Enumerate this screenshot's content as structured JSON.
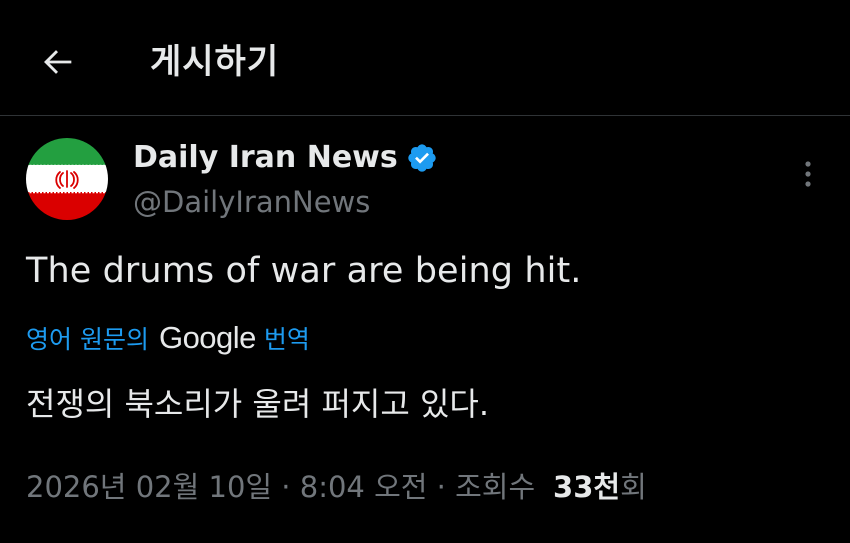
{
  "header": {
    "title": "게시하기",
    "back_icon": "arrow-left-icon"
  },
  "tweet": {
    "author": {
      "name": "Daily Iran News",
      "handle": "@DailyIranNews",
      "verified": true,
      "avatar": "iran-flag-icon"
    },
    "more_icon": "more-vertical-icon",
    "text": "The drums of war are being hit.",
    "translation": {
      "source_label": "영어 원문의",
      "provider": "Google",
      "action_label": "번역",
      "translated_text": "전쟁의 북소리가 울려 퍼지고 있다."
    },
    "meta": {
      "timestamp": "2026년 02월 10일 · 8:04 오전 · 조회수",
      "views_count": "33천",
      "views_suffix": "회"
    }
  },
  "colors": {
    "background": "#000000",
    "text_primary": "#e7e9ea",
    "text_secondary": "#71767b",
    "link": "#1d9bf0",
    "verified": "#1d9bf0",
    "divider": "#2f3336",
    "flag_green": "#239f40",
    "flag_white": "#ffffff",
    "flag_red": "#da0000"
  }
}
